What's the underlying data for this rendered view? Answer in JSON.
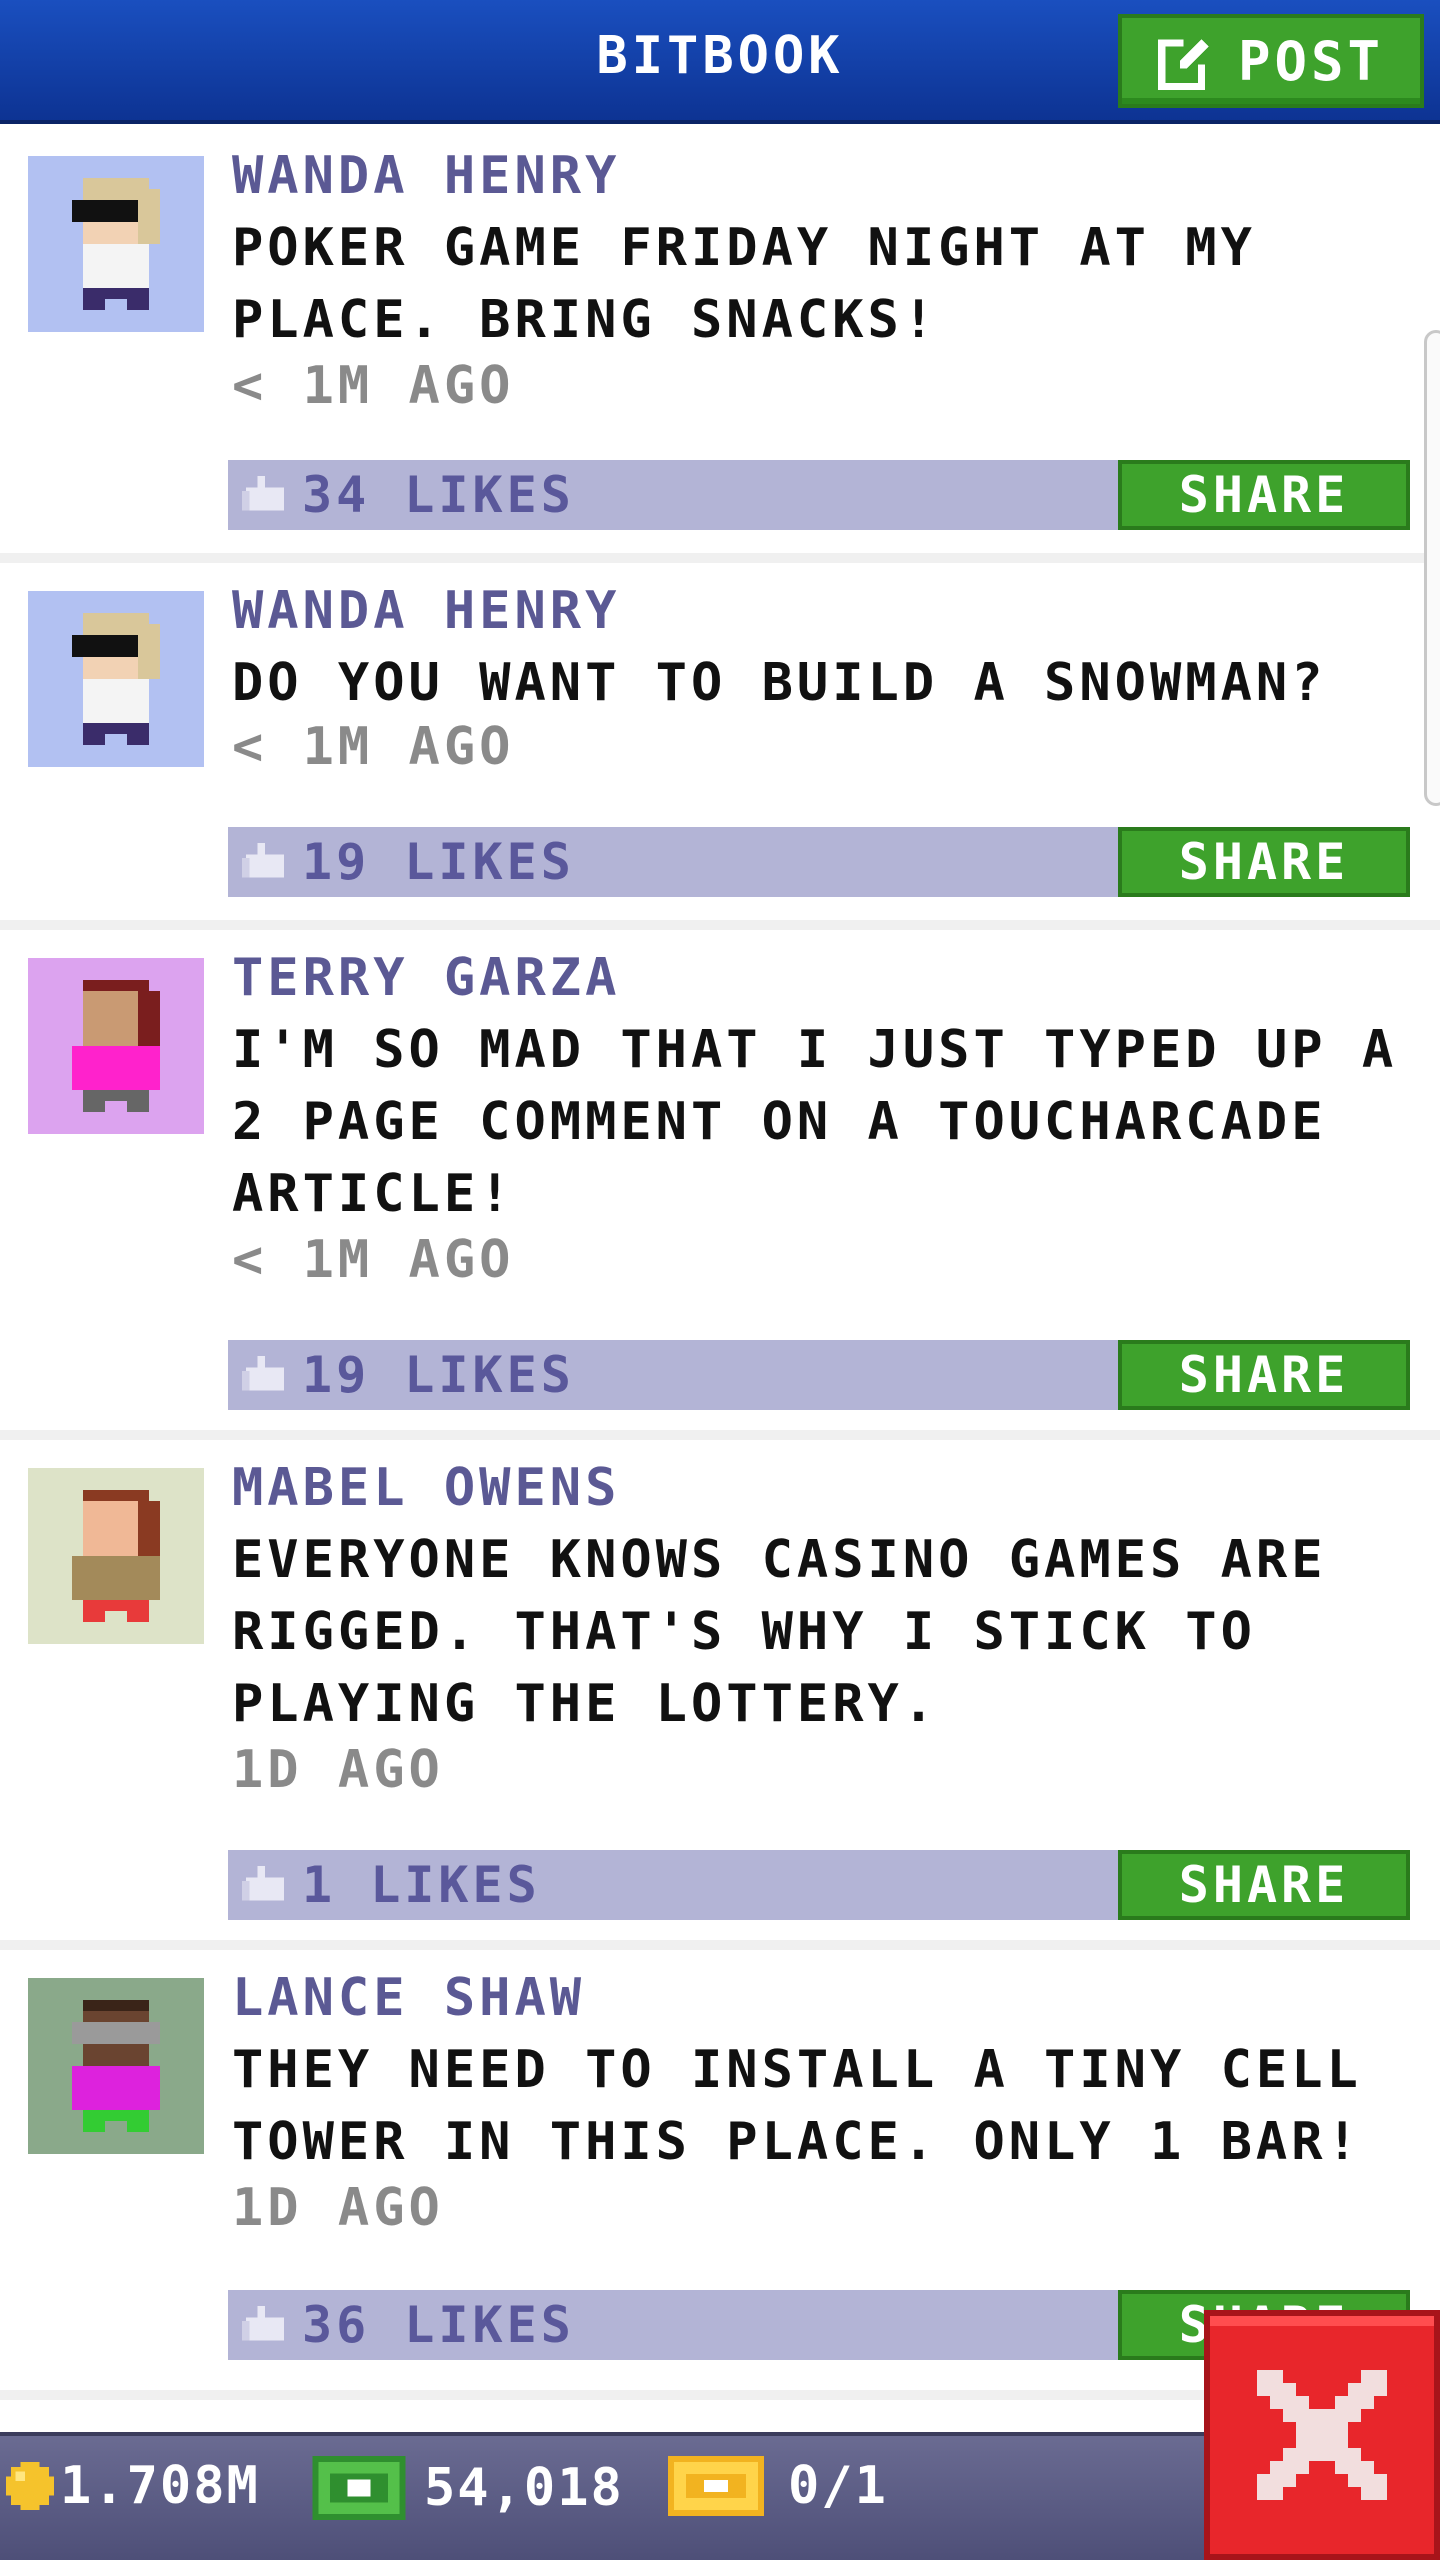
{
  "header": {
    "title": "BITBOOK",
    "post_label": "POST"
  },
  "feed": {
    "share_label": "SHARE",
    "posts": [
      {
        "author": "WANDA HENRY",
        "message": "POKER GAME FRIDAY NIGHT AT MY PLACE. BRING SNACKS!",
        "time": "< 1M AGO",
        "likes": "34 LIKES",
        "avatar_bg": "#b2c1f2"
      },
      {
        "author": "WANDA HENRY",
        "message": "DO YOU WANT TO BUILD A SNOWMAN?",
        "time": "< 1M AGO",
        "likes": "19 LIKES",
        "avatar_bg": "#b2c1f2"
      },
      {
        "author": "TERRY GARZA",
        "message": "I'M SO MAD THAT I JUST TYPED UP A 2 PAGE COMMENT ON A TOUCHARCADE ARTICLE!",
        "time": "< 1M AGO",
        "likes": "19 LIKES",
        "avatar_bg": "#dca3ef"
      },
      {
        "author": "MABEL OWENS",
        "message": "EVERYONE KNOWS CASINO GAMES ARE RIGGED. THAT'S WHY I STICK TO PLAYING THE LOTTERY.",
        "time": "1D AGO",
        "likes": "1 LIKES",
        "avatar_bg": "#dde3c8"
      },
      {
        "author": "LANCE SHAW",
        "message": "THEY NEED TO INSTALL A TINY CELL TOWER IN THIS PLACE. ONLY 1 BAR!",
        "time": "1D AGO",
        "likes": "36 LIKES",
        "avatar_bg": "#8aa98a"
      }
    ]
  },
  "footer": {
    "coins": "1.708M",
    "bux": "54,018",
    "tickets": "0/1"
  },
  "colors": {
    "header_blue": "#1a4fbf",
    "share_green": "#3ea22c",
    "like_bar": "#b3b4d6",
    "author_purple": "#5b5994",
    "close_red": "#e8262b"
  },
  "icons": [
    "edit-icon",
    "thumbs-up-icon",
    "coin-icon",
    "cash-icon",
    "ticket-icon",
    "close-icon"
  ]
}
